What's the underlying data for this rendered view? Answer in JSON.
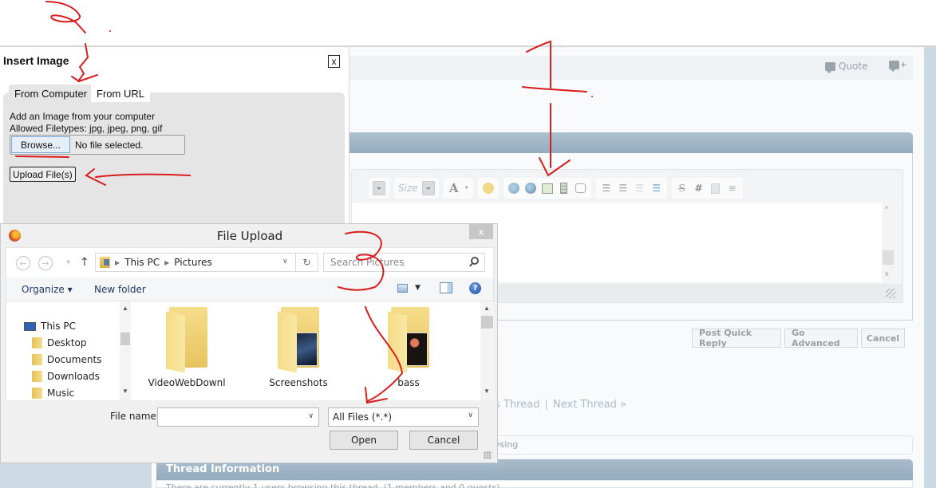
{
  "background_page": {
    "post_actions": {
      "quote_label": "Quote",
      "multiquote_icon": "multiquote-plus-icon"
    },
    "quick_reply": {
      "toolbar": {
        "size_label": "Size",
        "buttons": [
          "font-dropdown",
          "size-dropdown",
          "text-color",
          "smilies",
          "insert-link",
          "remove-link",
          "insert-image",
          "insert-video",
          "quote",
          "ordered-list",
          "unordered-list",
          "outdent",
          "indent",
          "strikethrough",
          "code-hash",
          "paste",
          "horizontal-rule"
        ]
      },
      "buttons": {
        "post": "Post Quick Reply",
        "advanced": "Go Advanced",
        "cancel": "Cancel"
      }
    },
    "thread_nav": {
      "prev": "s Thread",
      "separator": "|",
      "next": "Next Thread »"
    },
    "browsing_text": "ysing",
    "thread_info": {
      "title": "Thread Information",
      "text": "There are currently 1 users browsing this thread. (1 members and 0 guests)"
    }
  },
  "insert_image": {
    "title": "Insert Image",
    "close_label": "x",
    "tabs": [
      {
        "label": "From Computer",
        "active": true
      },
      {
        "label": "From URL",
        "active": false
      }
    ],
    "description": "Add an Image from your computer",
    "allowed_types": "Allowed Filetypes: jpg, jpeg, png, gif",
    "browse_label": "Browse...",
    "file_status": "No file selected.",
    "upload_label": "Upload File(s)"
  },
  "file_upload": {
    "title": "File Upload",
    "close_label": "x",
    "nav": {
      "back": "←",
      "forward": "→",
      "up": "↑",
      "refresh": "↻"
    },
    "address": [
      "This PC",
      "Pictures"
    ],
    "search_placeholder": "Search Pictures",
    "commands": {
      "organize": "Organize ▾",
      "new_folder": "New folder",
      "help": "?"
    },
    "tree": [
      "This PC",
      "Desktop",
      "Documents",
      "Downloads",
      "Music"
    ],
    "files": [
      {
        "name": "VideoWebDownl"
      },
      {
        "name": "Screenshots"
      },
      {
        "name": "bass"
      }
    ],
    "file_name_label": "File name:",
    "file_name_value": "",
    "file_type": "All Files (*.*)",
    "open_label": "Open",
    "cancel_label": "Cancel"
  },
  "annotations": {
    "labels": [
      "1",
      "2",
      "3"
    ],
    "color": "#d81e1e"
  }
}
